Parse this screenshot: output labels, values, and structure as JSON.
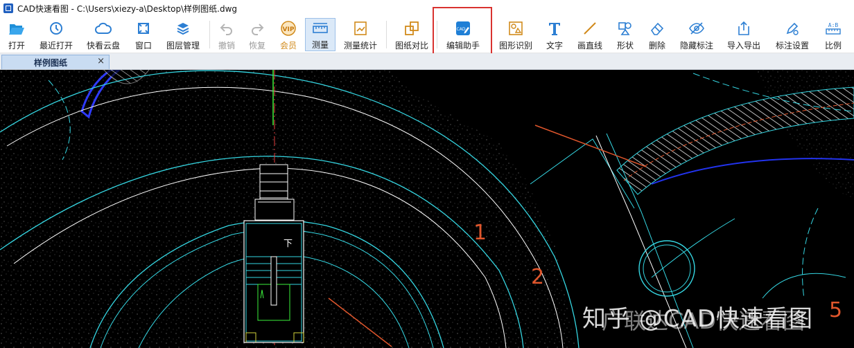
{
  "window": {
    "title": "CAD快速看图 - C:\\Users\\xiezy-a\\Desktop\\样例图纸.dwg"
  },
  "toolbar": {
    "open": "打开",
    "recent": "最近打开",
    "cloud": "快看云盘",
    "window": "窗口",
    "layers": "图层管理",
    "undo": "撤销",
    "redo": "恢复",
    "vip": "会员",
    "measure": "测量",
    "measure_stats": "测量统计",
    "compare": "图纸对比",
    "edit_assistant": "编辑助手",
    "shape_recog": "图形识别",
    "text": "文字",
    "line": "画直线",
    "shape": "形状",
    "delete": "删除",
    "hide_annot": "隐藏标注",
    "import_export": "导入导出",
    "annot_settings": "标注设置",
    "scale": "比例"
  },
  "icons": {
    "open": "folder-open-icon",
    "recent": "clock-icon",
    "cloud": "cloud-icon",
    "window": "window-icon",
    "layers": "layers-icon",
    "undo": "undo-icon",
    "redo": "redo-icon",
    "vip": "vip-badge-icon",
    "measure": "ruler-icon",
    "measure_stats": "chart-ruler-icon",
    "compare": "compare-sheets-icon",
    "edit_assistant": "edit-cad-icon",
    "shape_recog": "shape-recognize-icon",
    "text": "text-t-icon",
    "line": "line-draw-icon",
    "shape": "shapes-icon",
    "delete": "eraser-icon",
    "hide_annot": "eye-hidden-icon",
    "import_export": "export-icon",
    "annot_settings": "pen-gear-icon",
    "scale": "scale-ab-icon"
  },
  "tabs": [
    {
      "label": "样例图纸",
      "close": "×"
    }
  ],
  "drawing": {
    "labels": [
      "1",
      "2",
      "5"
    ],
    "stair_mark": "下",
    "watermark": "知乎 @CAD快速看图",
    "watermark_ghost": "广联达CAD快速看图"
  },
  "colors": {
    "accent": "#2d7fd3",
    "vip": "#d18a1b",
    "highlight": "#d9322f",
    "cyan": "#35d7e3",
    "orange": "#e0562c",
    "canvas_bg": "#000000"
  }
}
